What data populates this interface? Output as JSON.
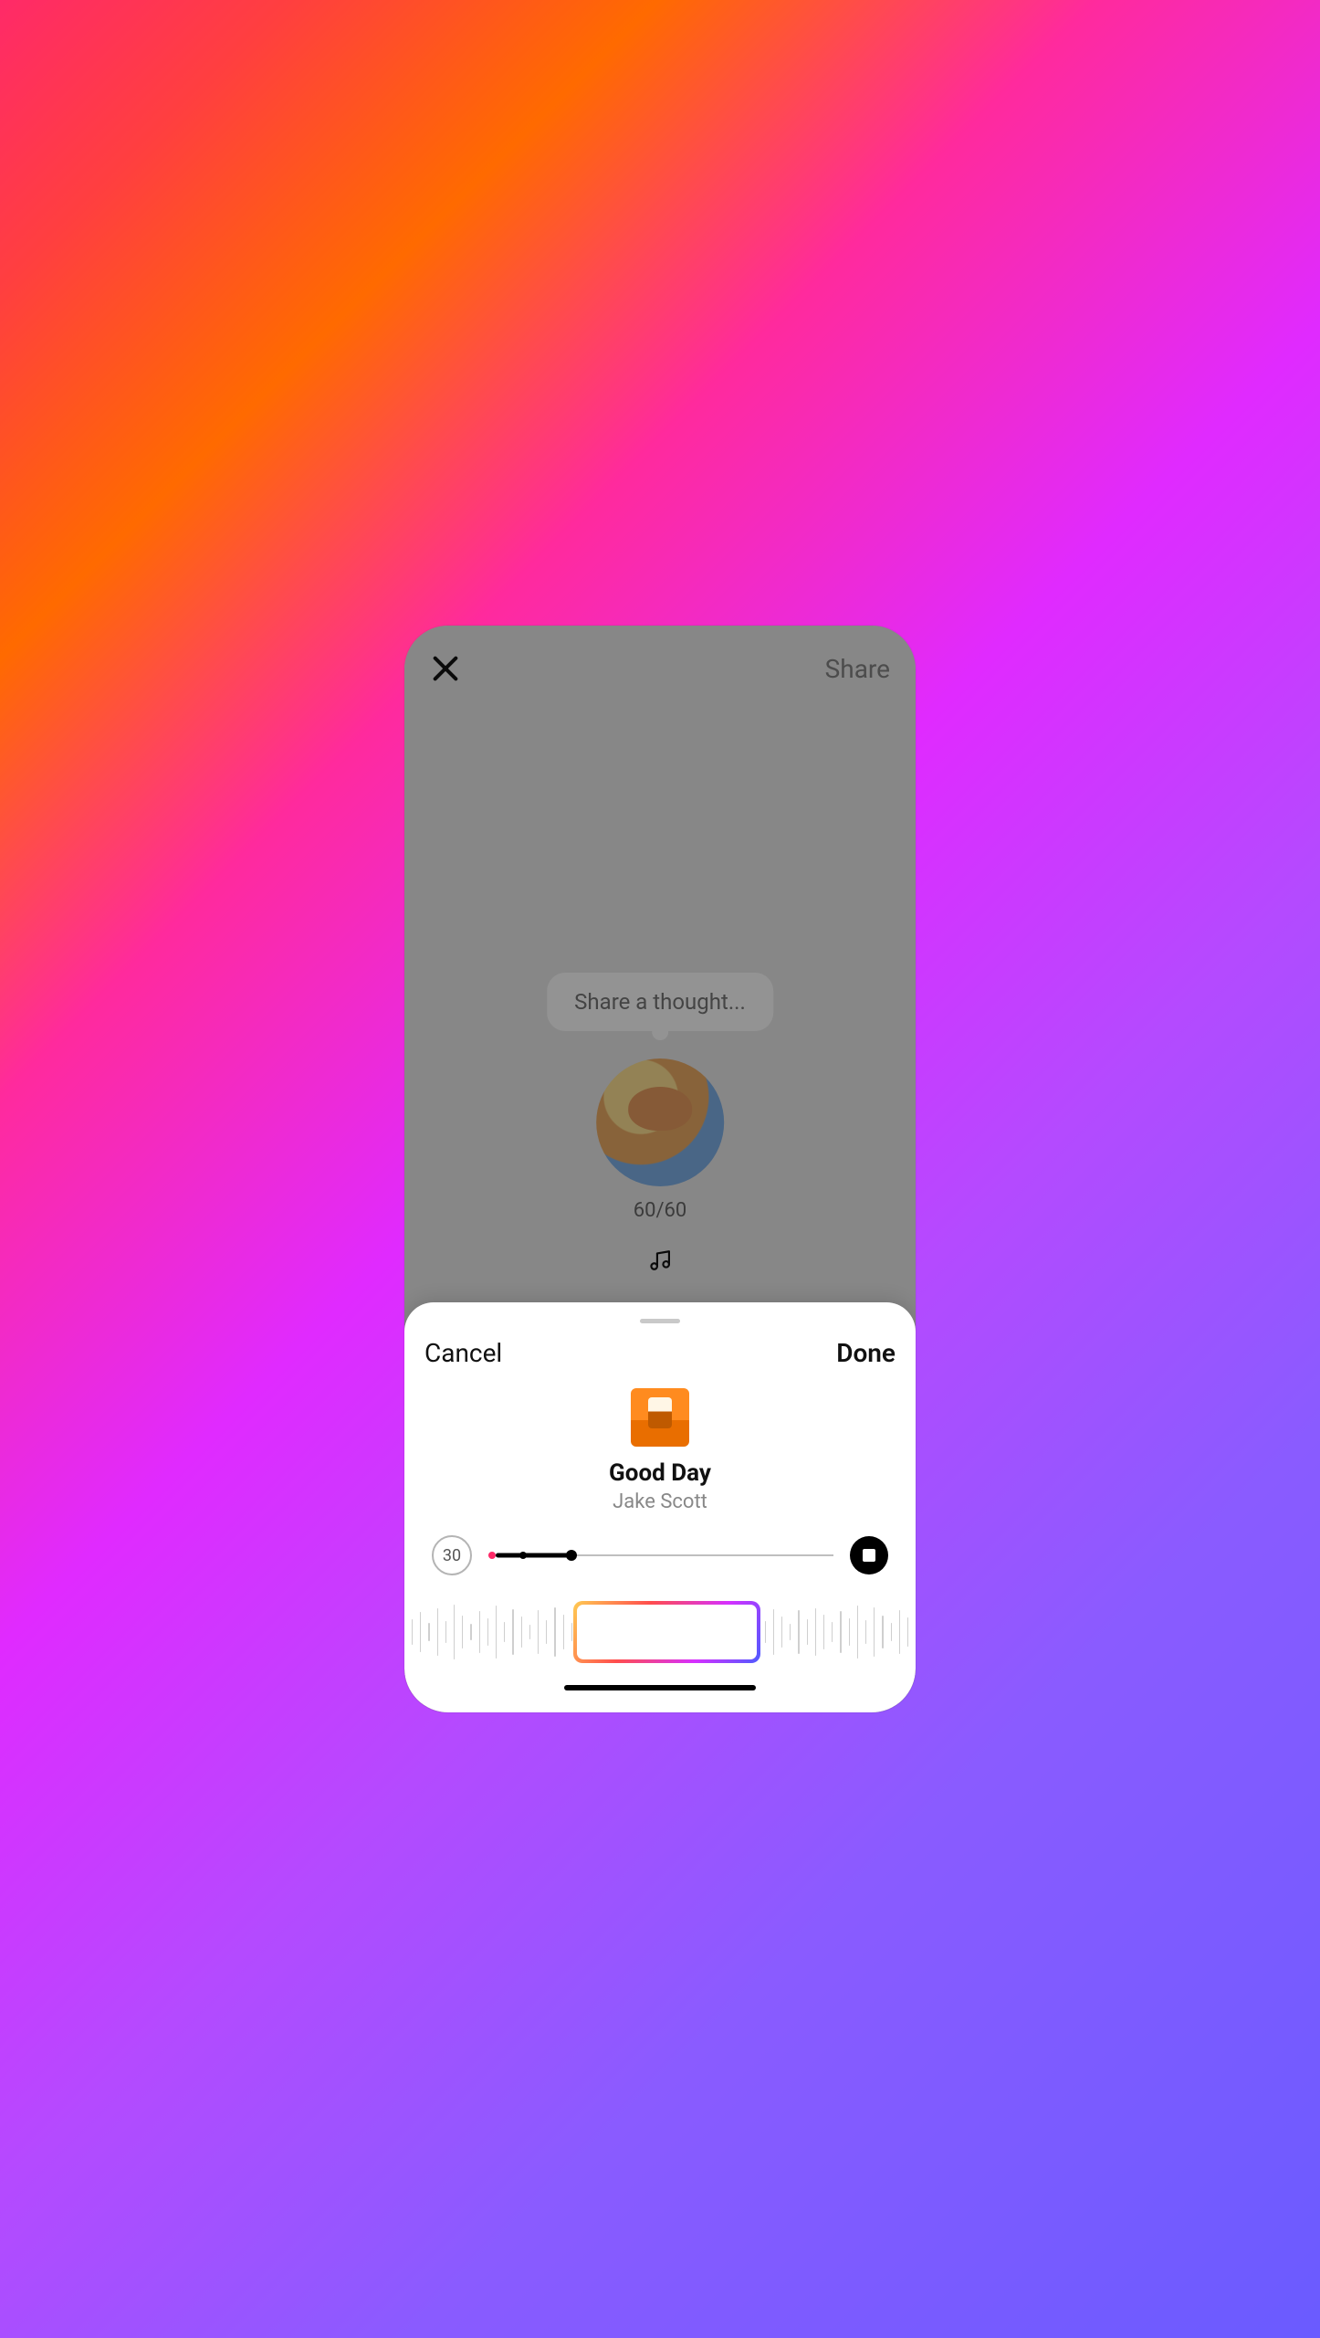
{
  "compose": {
    "share_label": "Share",
    "placeholder": "Share a thought...",
    "char_counter": "60/60"
  },
  "sheet": {
    "cancel_label": "Cancel",
    "done_label": "Done",
    "track_title": "Good Day",
    "track_artist": "Jake Scott",
    "clip_duration": "30"
  },
  "wave_bar_heights": [
    28,
    44,
    20,
    52,
    24,
    60,
    36,
    18,
    46,
    30,
    58,
    22,
    50,
    34,
    16,
    48,
    26,
    54,
    38,
    20,
    44,
    30,
    56,
    24,
    50,
    32,
    18,
    46,
    28,
    52,
    36,
    22,
    48,
    30,
    58,
    26,
    54,
    40,
    20,
    46,
    32,
    56,
    24,
    50,
    34,
    18,
    48,
    28,
    52,
    38,
    22,
    46,
    30,
    58,
    26,
    54,
    36,
    20,
    48,
    32
  ]
}
